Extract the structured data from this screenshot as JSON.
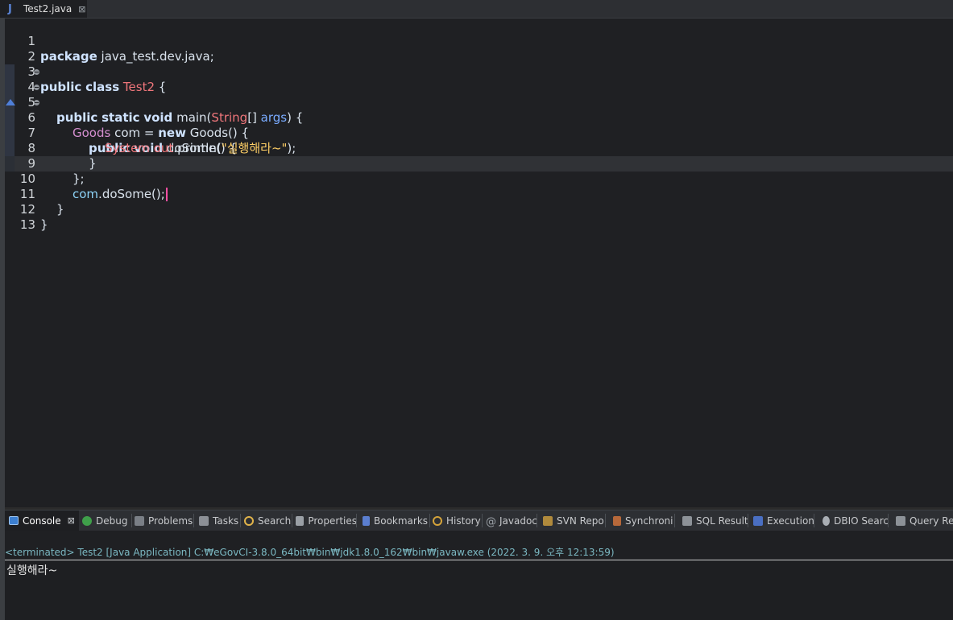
{
  "editor_tab": {
    "label": "Test2.java",
    "icon": "J",
    "close": "⊠"
  },
  "code_lines": [
    {
      "n": "1",
      "code": "package java_test.dev.java;"
    },
    {
      "n": "2",
      "code": ""
    },
    {
      "n": "3",
      "code": "public class Test2 {"
    },
    {
      "n": "4",
      "code": "public static void main(String[] args) {"
    },
    {
      "n": "5",
      "code": "Goods com = new Goods() {"
    },
    {
      "n": "6",
      "code": "public void doSome() {"
    },
    {
      "n": "7",
      "code": "System.out.println(\"실행해라~\");"
    },
    {
      "n": "8",
      "code": "}"
    },
    {
      "n": "9",
      "code": "};"
    },
    {
      "n": "10",
      "code": "com.doSome();"
    },
    {
      "n": "11",
      "code": "}"
    },
    {
      "n": "12",
      "code": "}"
    },
    {
      "n": "13",
      "code": ""
    }
  ],
  "tokens": {
    "package_kw": "package",
    "package_name": " java_test.dev.java;",
    "public_kw": "public",
    "class_kw": "class",
    "class_name": "Test2",
    "brace_open": " {",
    "static_kw": "static",
    "void_kw": "void",
    "main": "main(",
    "string_type": "String",
    "arr": "[] ",
    "args": "args",
    "paren_brace": ") {",
    "goods_type": "Goods",
    "com_decl": " com = ",
    "new_kw": "new",
    "goods_ctor": " Goods() {",
    "dosome_decl": " doSome() {",
    "system": "System",
    "dot1": ".",
    "out": "out",
    "println": ".println(",
    "string_literal": "\"실행해라~\"",
    "close_call": ");",
    "close_brace": "}",
    "close_anon": "};",
    "com_ref": "com",
    "dosome_call": ".doSome();"
  },
  "views": [
    {
      "label": "Console",
      "icon": "console-icon",
      "active": true,
      "close": "⊠"
    },
    {
      "label": "Debug",
      "icon": "debug-icon"
    },
    {
      "label": "Problems",
      "icon": "problems-icon"
    },
    {
      "label": "Tasks",
      "icon": "tasks-icon"
    },
    {
      "label": "Search",
      "icon": "search-icon"
    },
    {
      "label": "Properties",
      "icon": "properties-icon"
    },
    {
      "label": "Bookmarks",
      "icon": "bookmarks-icon"
    },
    {
      "label": "History",
      "icon": "history-icon"
    },
    {
      "label": "Javadoc",
      "icon": "javadoc-icon"
    },
    {
      "label": "SVN Repo",
      "icon": "svn-icon"
    },
    {
      "label": "Synchroni",
      "icon": "synchronize-icon"
    },
    {
      "label": "SQL Result",
      "icon": "sql-result-icon"
    },
    {
      "label": "Execution",
      "icon": "execution-icon"
    },
    {
      "label": "DBIO Searc",
      "icon": "dbio-search-icon"
    },
    {
      "label": "Query Res",
      "icon": "query-result-icon"
    }
  ],
  "console": {
    "status": "<terminated> Test2 [Java Application] C:₩eGovCI-3.8.0_64bit₩bin₩jdk1.8.0_162₩bin₩javaw.exe (2022. 3. 9. 오후 12:13:59)",
    "output": "실행해라~"
  },
  "colors": {
    "keyword": "#cfe3ff",
    "class_name": "#f0767b",
    "type": "#d58fd0",
    "param": "#79abff",
    "string": "#ffcf66",
    "field": "#8dd3f7",
    "caret": "#ff4fa3",
    "console_status": "#7bb8c2"
  }
}
